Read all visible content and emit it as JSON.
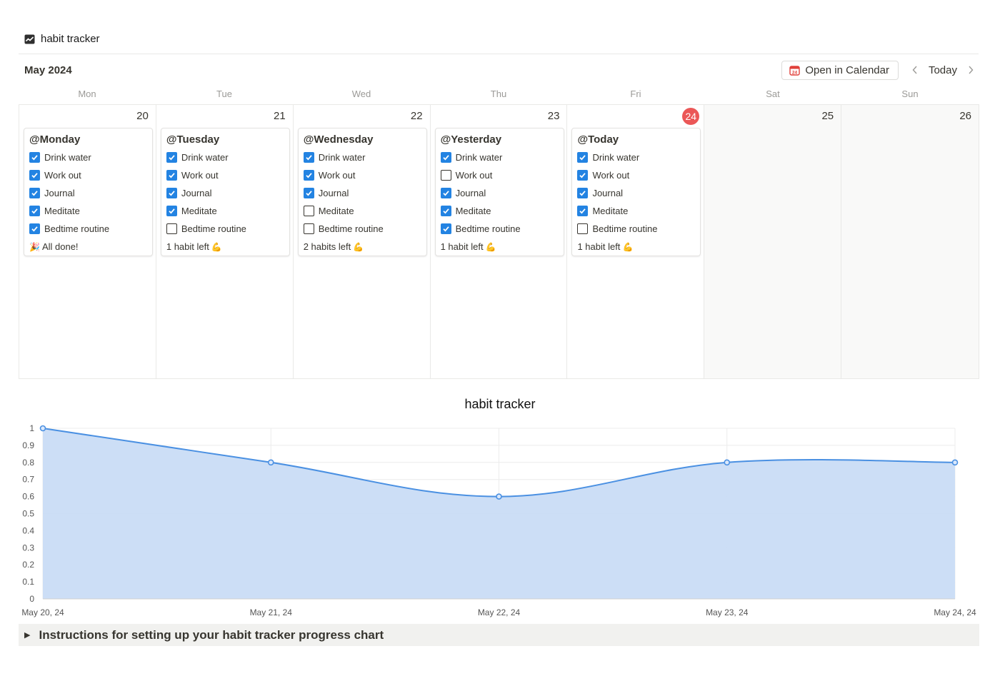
{
  "page": {
    "title": "habit tracker",
    "icon": "chart-line-icon"
  },
  "calendar": {
    "month_label": "May 2024",
    "open_button": "Open in Calendar",
    "today_button": "Today",
    "weekdays": [
      "Mon",
      "Tue",
      "Wed",
      "Thu",
      "Fri",
      "Sat",
      "Sun"
    ],
    "days": [
      {
        "num": "20",
        "title": "@Monday",
        "status": "All done!",
        "status_emoji": "🎉",
        "emoji_before": true,
        "habits": [
          {
            "label": "Drink water",
            "checked": true
          },
          {
            "label": "Work out",
            "checked": true
          },
          {
            "label": "Journal",
            "checked": true
          },
          {
            "label": "Meditate",
            "checked": true
          },
          {
            "label": "Bedtime routine",
            "checked": true
          }
        ]
      },
      {
        "num": "21",
        "title": "@Tuesday",
        "status": "1 habit left",
        "status_emoji": "💪",
        "emoji_before": false,
        "habits": [
          {
            "label": "Drink water",
            "checked": true
          },
          {
            "label": "Work out",
            "checked": true
          },
          {
            "label": "Journal",
            "checked": true
          },
          {
            "label": "Meditate",
            "checked": true
          },
          {
            "label": "Bedtime routine",
            "checked": false
          }
        ]
      },
      {
        "num": "22",
        "title": "@Wednesday",
        "status": "2 habits left",
        "status_emoji": "💪",
        "emoji_before": false,
        "habits": [
          {
            "label": "Drink water",
            "checked": true
          },
          {
            "label": "Work out",
            "checked": true
          },
          {
            "label": "Journal",
            "checked": true
          },
          {
            "label": "Meditate",
            "checked": false
          },
          {
            "label": "Bedtime routine",
            "checked": false
          }
        ]
      },
      {
        "num": "23",
        "title": "@Yesterday",
        "status": "1 habit left",
        "status_emoji": "💪",
        "emoji_before": false,
        "habits": [
          {
            "label": "Drink water",
            "checked": true
          },
          {
            "label": "Work out",
            "checked": false
          },
          {
            "label": "Journal",
            "checked": true
          },
          {
            "label": "Meditate",
            "checked": true
          },
          {
            "label": "Bedtime routine",
            "checked": true
          }
        ]
      },
      {
        "num": "24",
        "title": "@Today",
        "status": "1 habit left",
        "status_emoji": "💪",
        "emoji_before": false,
        "is_today": true,
        "habits": [
          {
            "label": "Drink water",
            "checked": true
          },
          {
            "label": "Work out",
            "checked": true
          },
          {
            "label": "Journal",
            "checked": true
          },
          {
            "label": "Meditate",
            "checked": true
          },
          {
            "label": "Bedtime routine",
            "checked": false
          }
        ]
      },
      {
        "num": "25",
        "weekend": true
      },
      {
        "num": "26",
        "weekend": true
      }
    ]
  },
  "chart_data": {
    "type": "area",
    "title": "habit tracker",
    "x": [
      "May 20, 24",
      "May 21, 24",
      "May 22, 24",
      "May 23, 24",
      "May 24, 24"
    ],
    "series": [
      {
        "values": [
          1,
          0.8,
          0.6,
          0.8,
          0.8
        ]
      }
    ],
    "ylim": [
      0,
      1
    ],
    "yticks": [
      "0",
      "0.1",
      "0.2",
      "0.3",
      "0.4",
      "0.5",
      "0.6",
      "0.7",
      "0.8",
      "0.9",
      "1"
    ],
    "grid": true,
    "line_color": "#4a90e2",
    "fill_color": "#c9dcf5"
  },
  "toggle": {
    "label": "Instructions for setting up your habit tracker progress chart"
  },
  "colors": {
    "checkbox": "#2383e2",
    "today_badge": "#eb5757"
  }
}
